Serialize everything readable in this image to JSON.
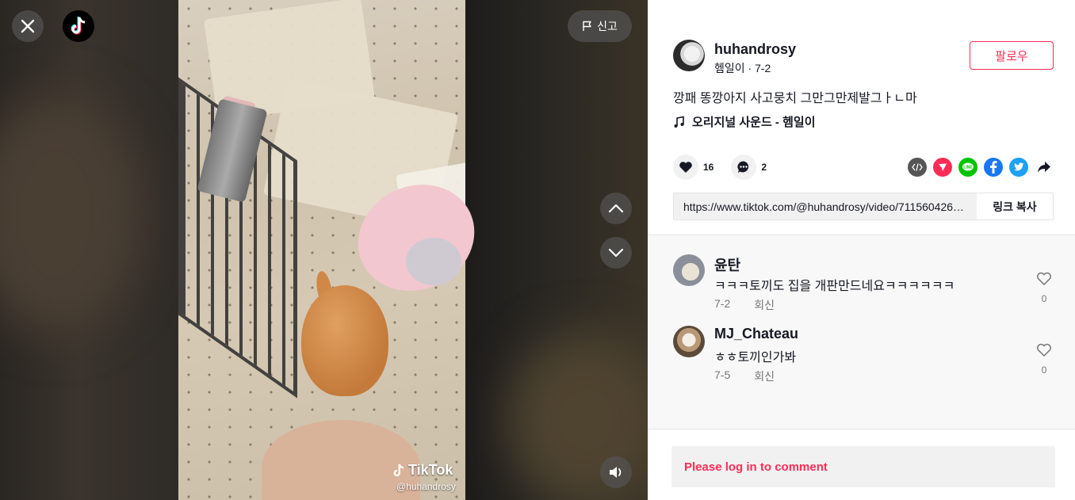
{
  "video": {
    "report_label": "신고",
    "watermark_brand": "TikTok",
    "watermark_user": "@huhandrosy"
  },
  "author": {
    "username": "huhandrosy",
    "subline": "헴일이 · 7-2",
    "follow_label": "팔로우"
  },
  "post": {
    "caption": "깡패 똥깡아지 사고뭉치 그만그만제발그ㅏㄴ마",
    "music": "오리지널 사운드 - 헴일이"
  },
  "stats": {
    "likes": "16",
    "comments": "2"
  },
  "link": {
    "url": "https://www.tiktok.com/@huhandrosy/video/711560426416...",
    "copy_label": "링크 복사"
  },
  "comments": [
    {
      "name": "윤탄",
      "text": "ㅋㅋㅋ토끼도 집을 개판만드네요ㅋㅋㅋㅋㅋㅋ",
      "date": "7-2",
      "reply": "회신",
      "likes": "0"
    },
    {
      "name": "MJ_Chateau",
      "text": "ㅎㅎ토끼인가봐",
      "date": "7-5",
      "reply": "회신",
      "likes": "0"
    }
  ],
  "login_prompt": "Please log in to comment",
  "colors": {
    "accent": "#fe2c55",
    "share_embed": "#555555",
    "share_direct": "#fe2c55",
    "share_line": "#00c300",
    "share_facebook": "#1877f2",
    "share_twitter": "#1da1f2"
  }
}
